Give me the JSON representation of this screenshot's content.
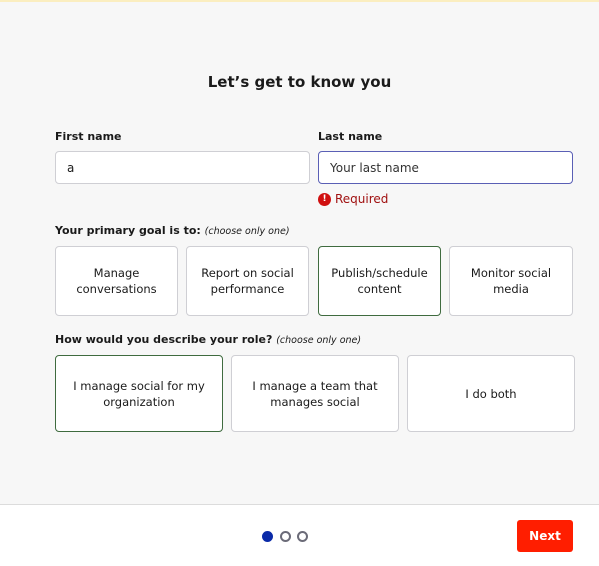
{
  "title": "Let’s get to know you",
  "first_name": {
    "label": "First name",
    "value": "a"
  },
  "last_name": {
    "label": "Last name",
    "placeholder": "Your last name",
    "error": "Required"
  },
  "goal": {
    "label": "Your primary goal is to:",
    "hint": "(choose only one)",
    "options": [
      "Manage conversations",
      "Report on social performance",
      "Publish/schedule content",
      "Monitor social media"
    ],
    "selected": 2
  },
  "role": {
    "label": "How would you describe your role?",
    "hint": "(choose only one)",
    "options": [
      "I manage social for my organization",
      "I manage a team that manages social",
      "I do both"
    ],
    "selected": 0
  },
  "pagination": {
    "current": 1,
    "total": 3
  },
  "next_label": "Next",
  "colors": {
    "accent": "#ff1e00",
    "selected_border": "#3f6b3f",
    "error": "#d01010",
    "active_dot": "#0a2aa8"
  }
}
